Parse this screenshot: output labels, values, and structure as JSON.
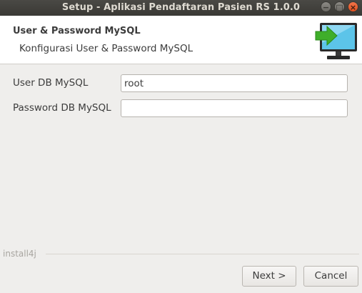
{
  "window": {
    "title": "Setup - Aplikasi Pendaftaran Pasien RS 1.0.0",
    "controls": {
      "minimize": "−",
      "maximize": "□",
      "close": "×"
    }
  },
  "header": {
    "title": "User & Password MySQL",
    "subtitle": "Konfigurasi User & Password MySQL",
    "icon": "monitor-arrow-icon"
  },
  "form": {
    "user_label": "User DB MySQL",
    "user_value": "root",
    "password_label": "Password DB MySQL",
    "password_value": ""
  },
  "footer": {
    "brand": "install4j",
    "next_label": "Next >",
    "cancel_label": "Cancel"
  },
  "colors": {
    "titlebar": "#3c3b37",
    "close_button": "#e95420",
    "monitor_screen": "#5cc4e9",
    "arrow": "#3fae2a"
  }
}
